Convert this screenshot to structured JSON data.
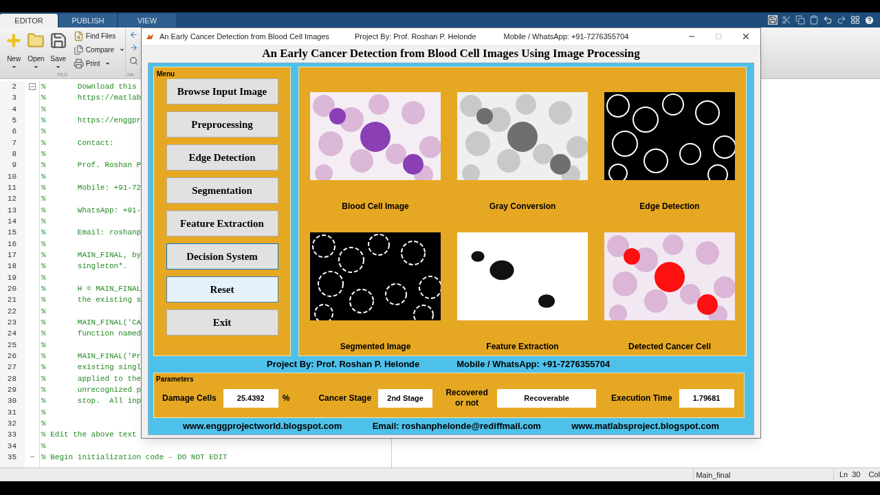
{
  "editor_tabs": [
    {
      "label": "EDITOR",
      "selected": true
    },
    {
      "label": "PUBLISH",
      "selected": false
    },
    {
      "label": "VIEW",
      "selected": false
    }
  ],
  "toolbar": {
    "big_buttons": [
      "New",
      "Open",
      "Save"
    ],
    "small_buttons": [
      {
        "label": "Find Files",
        "dropdown": false
      },
      {
        "label": "Compare",
        "dropdown": true
      },
      {
        "label": "Print",
        "dropdown": true
      }
    ],
    "section_labels": [
      "FILE",
      "NA"
    ]
  },
  "code_lines": [
    {
      "number": "2",
      "text": "%       Download this",
      "kind": "start"
    },
    {
      "number": "3",
      "text": "%       https://matlab"
    },
    {
      "number": "4",
      "text": "%"
    },
    {
      "number": "5",
      "text": "%       https://enggpr"
    },
    {
      "number": "6",
      "text": "%"
    },
    {
      "number": "7",
      "text": "%       Contact:"
    },
    {
      "number": "8",
      "text": "%"
    },
    {
      "number": "9",
      "text": "%       Prof. Roshan P"
    },
    {
      "number": "10",
      "text": "%"
    },
    {
      "number": "11",
      "text": "%       Mobile: +91-72"
    },
    {
      "number": "12",
      "text": "%"
    },
    {
      "number": "13",
      "text": "%       WhatsApp: +91-"
    },
    {
      "number": "14",
      "text": "%"
    },
    {
      "number": "15",
      "text": "%       Email: roshanp"
    },
    {
      "number": "16",
      "text": "%"
    },
    {
      "number": "17",
      "text": "%       MAIN_FINAL, by"
    },
    {
      "number": "18",
      "text": "%       singleton*."
    },
    {
      "number": "19",
      "text": "%"
    },
    {
      "number": "20",
      "text": "%       H = MAIN_FINAL"
    },
    {
      "number": "21",
      "text": "%       the existing s"
    },
    {
      "number": "22",
      "text": "%"
    },
    {
      "number": "23",
      "text": "%       MAIN_FINAL('CA"
    },
    {
      "number": "24",
      "text": "%       function named"
    },
    {
      "number": "25",
      "text": "%"
    },
    {
      "number": "26",
      "text": "%       MAIN_FINAL('Pr"
    },
    {
      "number": "27",
      "text": "%       existing singl"
    },
    {
      "number": "28",
      "text": "%       applied to the"
    },
    {
      "number": "29",
      "text": "%       unrecognized p"
    },
    {
      "number": "30",
      "text": "%       stop.  All inp"
    },
    {
      "number": "31",
      "text": "%"
    },
    {
      "number": "32",
      "text": "%"
    },
    {
      "number": "33",
      "text": "% Edit the above text"
    },
    {
      "number": "34",
      "text": "%"
    },
    {
      "number": "35",
      "text": "% Begin initialization code - DO NOT EDIT",
      "kind": "end"
    }
  ],
  "app_window": {
    "title": "An Early Cancer Detection from Blood Cell Images",
    "title_project": "Project By: Prof. Roshan P. Helonde",
    "title_contact": "Mobile / WhatsApp: +91-7276355704",
    "heading": "An Early Cancer Detection from Blood Cell Images Using Image Processing",
    "menu": {
      "label": "Menu",
      "buttons": [
        {
          "label": "Browse Input Image",
          "focused": false,
          "hovered": false
        },
        {
          "label": "Preprocessing",
          "focused": false,
          "hovered": false
        },
        {
          "label": "Edge Detection",
          "focused": false,
          "hovered": false
        },
        {
          "label": "Segmentation",
          "focused": false,
          "hovered": false
        },
        {
          "label": "Feature Extraction",
          "focused": false,
          "hovered": false
        },
        {
          "label": "Decision System",
          "focused": true,
          "hovered": false
        },
        {
          "label": "Reset",
          "focused": false,
          "hovered": true
        },
        {
          "label": "Exit",
          "focused": false,
          "hovered": false
        }
      ]
    },
    "images": [
      {
        "kind": "picture",
        "caption": "Blood Cell Image"
      },
      {
        "kind": "picture",
        "caption": "Gray Conversion"
      },
      {
        "kind": "picture",
        "caption": "Edge Detection"
      },
      {
        "kind": "picture",
        "caption": "Segmented Image"
      },
      {
        "kind": "picture",
        "caption": "Feature Extraction"
      },
      {
        "kind": "picture",
        "caption": "Detected Cancer Cell"
      }
    ],
    "project_line": "Project By: Prof. Roshan P. Helonde",
    "contact_line": "Mobile / WhatsApp: +91-7276355704",
    "parameters": {
      "label": "Parameters",
      "items": [
        {
          "label": "Damage Cells",
          "value": "25.4392",
          "unit": "%"
        },
        {
          "label": "Cancer Stage",
          "value": "2nd Stage"
        },
        {
          "label": "Recovered or not",
          "value": "Recoverable"
        },
        {
          "label": "Execution Time",
          "value": "1.79681"
        }
      ]
    },
    "footer_links": [
      "www.enggprojectworld.blogspot.com",
      "Email: roshanphelonde@rediffmail.com",
      "www.matlabsproject.blogspot.com"
    ]
  },
  "status_bar": {
    "file": "Main_final",
    "line": "Ln  30",
    "column": "Col"
  }
}
